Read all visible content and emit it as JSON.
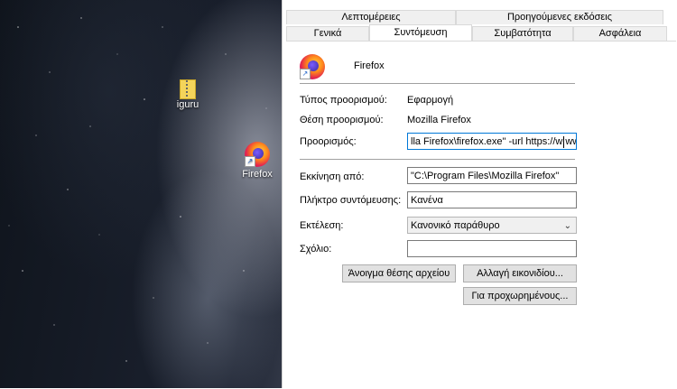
{
  "desktop": {
    "icons": [
      {
        "label": "iguru"
      },
      {
        "label": "Firefox"
      }
    ]
  },
  "dialog": {
    "tabs_top": [
      "Λεπτομέρειες",
      "Προηγούμενες εκδόσεις"
    ],
    "tabs_bottom": [
      "Γενικά",
      "Συντόμευση",
      "Συμβατότητα",
      "Ασφάλεια"
    ],
    "active_tab": "Συντόμευση",
    "name": "Firefox",
    "target_type_label": "Τύπος προορισμού:",
    "target_type_value": "Εφαρμογή",
    "target_location_label": "Θέση προορισμού:",
    "target_location_value": "Mozilla Firefox",
    "target_label": "Προορισμός:",
    "target_value_a": "lla Firefox\\firefox.exe\" -url https://w",
    "target_value_b": "ww.youtut",
    "start_in_label": "Εκκίνηση από:",
    "start_in_value": "\"C:\\Program Files\\Mozilla Firefox\"",
    "shortcut_key_label": "Πλήκτρο συντόμευσης:",
    "shortcut_key_value": "Κανένα",
    "run_label": "Εκτέλεση:",
    "run_value": "Κανονικό παράθυρο",
    "comment_label": "Σχόλιο:",
    "comment_value": "",
    "open_location_button": "Άνοιγμα θέσης αρχείου",
    "change_icon_button": "Αλλαγή εικονιδίου...",
    "advanced_button": "Για προχωρημένους..."
  }
}
